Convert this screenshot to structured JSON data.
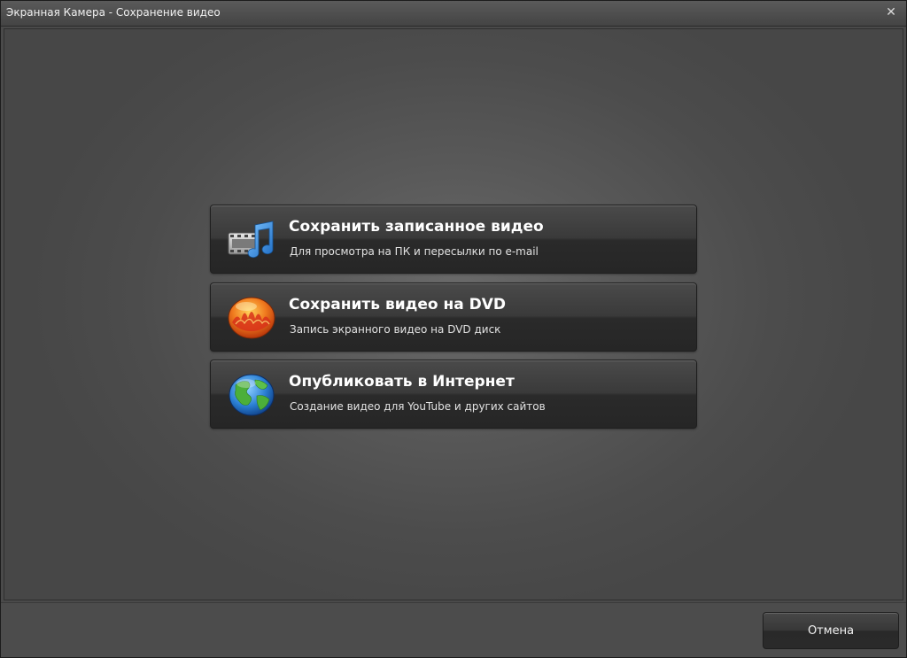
{
  "window": {
    "title": "Экранная Камера - Сохранение видео",
    "close_symbol": "✕"
  },
  "options": [
    {
      "title": "Сохранить записанное видео",
      "subtitle": "Для просмотра на ПК и пересылки по e-mail",
      "icon": "film-music-icon"
    },
    {
      "title": "Сохранить видео на DVD",
      "subtitle": "Запись экранного видео на DVD диск",
      "icon": "dvd-disc-icon"
    },
    {
      "title": "Опубликовать в Интернет",
      "subtitle": "Создание видео для YouTube и других сайтов",
      "icon": "globe-icon"
    }
  ],
  "footer": {
    "cancel_label": "Отмена"
  },
  "colors": {
    "background": "#4a4a4a",
    "button_dark": "#2a2a2a",
    "text": "#ffffff",
    "dvd_orange": "#e8601a",
    "globe_blue": "#2a7fd4",
    "globe_green": "#4caf3a",
    "note_blue": "#3a8fe0"
  }
}
